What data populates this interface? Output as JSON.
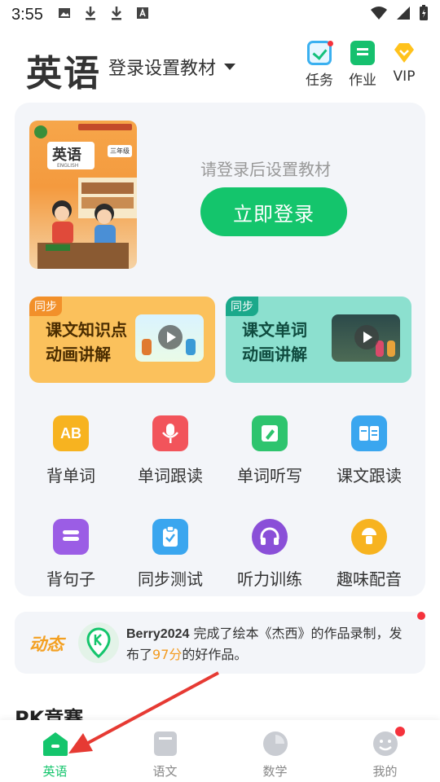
{
  "status_bar": {
    "time": "3:55"
  },
  "header": {
    "subject": "英语",
    "textbook_select": "登录设置教材",
    "actions": [
      {
        "label": "任务",
        "icon": "task-checklist-icon"
      },
      {
        "label": "作业",
        "icon": "homework-icon"
      },
      {
        "label": "VIP",
        "icon": "vip-diamond-icon"
      }
    ]
  },
  "textbook": {
    "cover_title": "英语",
    "cover_subtitle": "ENGLISH",
    "cover_grade": "三年级",
    "login_prompt": "请登录后设置教材",
    "login_button": "立即登录"
  },
  "courses": [
    {
      "tag": "同步",
      "title_line1": "课文知识点",
      "title_line2": "动画讲解",
      "color": "#fbc15c"
    },
    {
      "tag": "同步",
      "title_line1": "课文单词",
      "title_line2": "动画讲解",
      "color": "#8ce0cf"
    }
  ],
  "features": [
    {
      "label": "背单词",
      "icon": "ab-letters-icon",
      "glyph": "AB"
    },
    {
      "label": "单词跟读",
      "icon": "microphone-icon"
    },
    {
      "label": "单词听写",
      "icon": "pencil-write-icon"
    },
    {
      "label": "课文跟读",
      "icon": "open-book-icon"
    },
    {
      "label": "背句子",
      "icon": "sentence-lines-icon"
    },
    {
      "label": "同步测试",
      "icon": "clipboard-check-icon"
    },
    {
      "label": "听力训练",
      "icon": "headphones-icon"
    },
    {
      "label": "趣味配音",
      "icon": "dubbing-lamp-icon"
    }
  ],
  "feed": {
    "tag": "动态",
    "user": "Berry2024",
    "text_before": " 完成了绘本《杰西》的作品录制，发布了",
    "score": "97分",
    "text_after": "的好作品。"
  },
  "pk_title": "PK竞赛",
  "bottom_nav": [
    {
      "label": "英语",
      "icon": "home-icon",
      "active": true
    },
    {
      "label": "语文",
      "icon": "chinese-book-icon",
      "active": false
    },
    {
      "label": "数学",
      "icon": "math-circle-icon",
      "active": false
    },
    {
      "label": "我的",
      "icon": "profile-face-icon",
      "active": false
    }
  ],
  "colors": {
    "accent": "#14c56c",
    "score": "#f39a1e",
    "badge": "#f5323c"
  }
}
